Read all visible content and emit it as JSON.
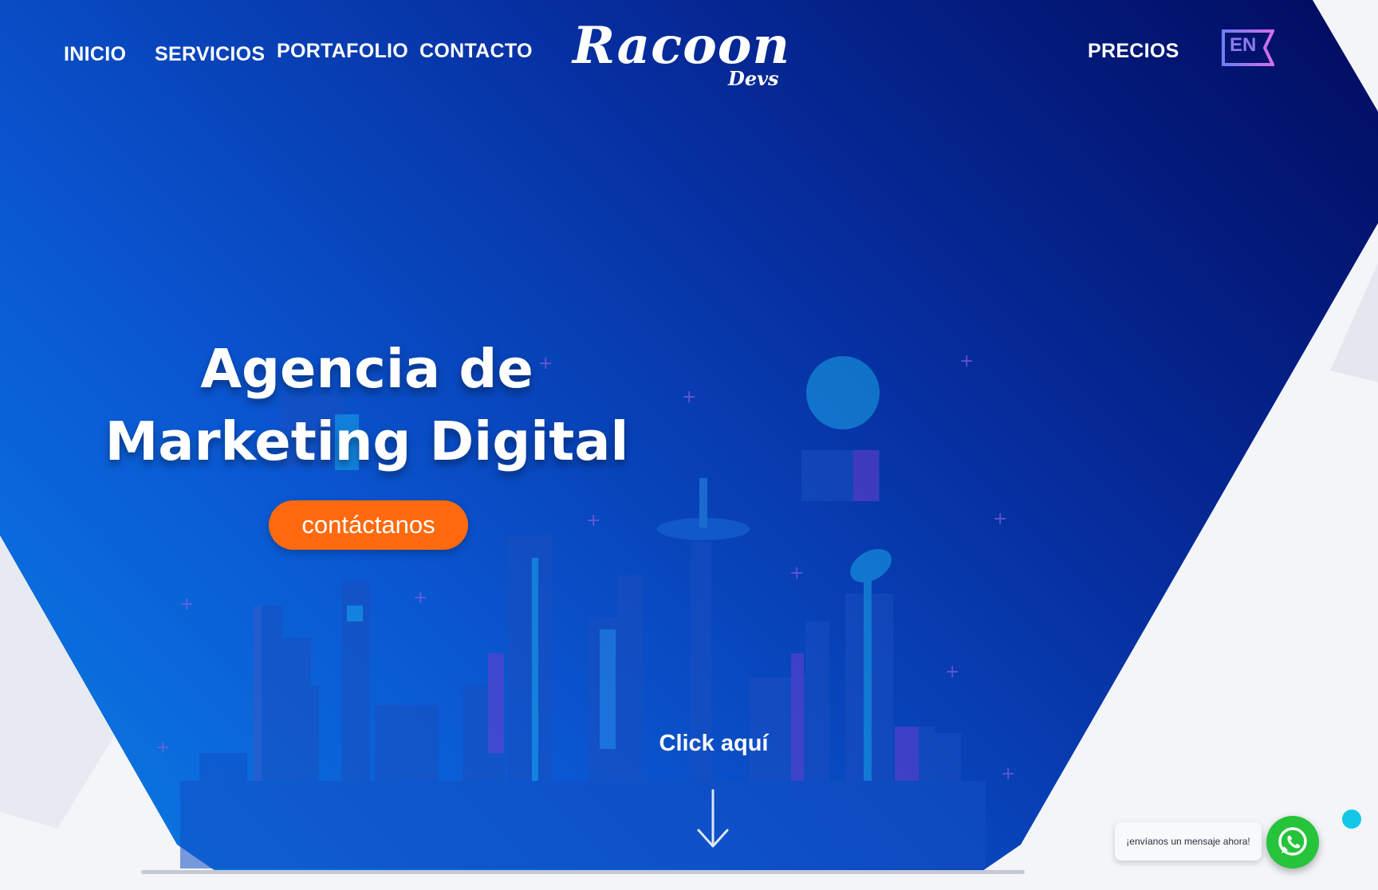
{
  "nav": {
    "items": [
      {
        "label": "INICIO"
      },
      {
        "label": "SERVICIOS"
      },
      {
        "label": "PORTAFOLIO"
      },
      {
        "label": "CONTACTO"
      }
    ],
    "right_label": "PRECIOS",
    "language_badge": "EN"
  },
  "logo": {
    "main": "Racoon",
    "sub": "Devs"
  },
  "hero": {
    "title_line1": "Agencia de",
    "title_line2": "Marketing Digital",
    "cta_label": "contáctanos",
    "scroll_label": "Click aquí",
    "scroll_icon": "arrow-down-icon"
  },
  "whatsapp": {
    "message": "¡envíanos un mensaje ahora!",
    "icon": "whatsapp-icon"
  },
  "colors": {
    "hero_gradient_start": "#0a7de4",
    "hero_gradient_end": "#010b5e",
    "cta": "#ff6a0e",
    "whatsapp": "#25c43a",
    "accent_dot": "#12c8e6"
  }
}
